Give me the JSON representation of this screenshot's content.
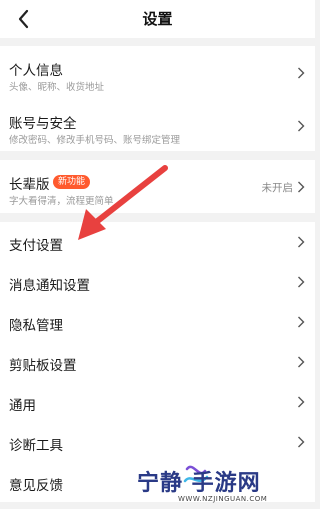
{
  "header": {
    "title": "设置"
  },
  "group1": [
    {
      "label": "个人信息",
      "sub": "头像、昵称、收货地址"
    },
    {
      "label": "账号与安全",
      "sub": "修改密码、修改手机号码、账号绑定管理"
    }
  ],
  "elder": {
    "label": "长辈版",
    "badge": "新功能",
    "sub": "字大看得清，流程更简单",
    "status": "未开启"
  },
  "group3": [
    {
      "label": "支付设置"
    },
    {
      "label": "消息通知设置"
    },
    {
      "label": "隐私管理"
    },
    {
      "label": "剪贴板设置"
    },
    {
      "label": "通用"
    },
    {
      "label": "诊断工具"
    },
    {
      "label": "意见反馈"
    }
  ],
  "watermark": {
    "name": "宁静  手游网",
    "url": "WWW.NZJINGUAN.COM"
  },
  "colors": {
    "badge": "#ff5a2e",
    "arrow": "#e8413f",
    "watermark": "#2a3a86"
  }
}
